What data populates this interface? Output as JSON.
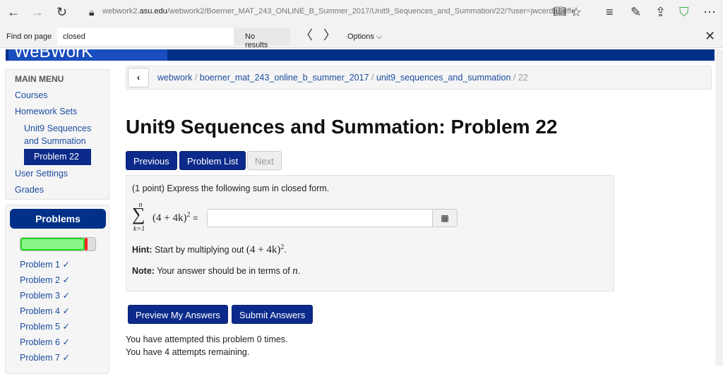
{
  "browser": {
    "url_prefix": "webwork2.",
    "url_domain": "asu.edu",
    "url_rest": "/webwork2/Boerner_MAT_243_ONLINE_B_Summer_2017/Unit9_Sequences_and_Summation/22/?user=jwcerda&effe"
  },
  "find": {
    "label": "Find on page",
    "value": "closed",
    "results": "No results",
    "options": "Options"
  },
  "banner": "WeBWorK",
  "menu": {
    "title": "MAIN MENU",
    "courses": "Courses",
    "homework_sets": "Homework Sets",
    "set_line1": "Unit9 Sequences",
    "set_line2": "and Summation",
    "problem": "Problem 22",
    "user_settings": "User Settings",
    "grades": "Grades"
  },
  "problems": {
    "title": "Problems",
    "progress": {
      "correct": 0.86,
      "incorrect": 0.04
    },
    "items": [
      "Problem 1 ✓",
      "Problem 2 ✓",
      "Problem 3 ✓",
      "Problem 4 ✓",
      "Problem 5 ✓",
      "Problem 6 ✓",
      "Problem 7 ✓"
    ]
  },
  "breadcrumb": {
    "items": [
      "webwork",
      "boerner_mat_243_online_b_summer_2017",
      "unit9_sequences_and_summation"
    ],
    "current": "22",
    "sep": "/"
  },
  "title": "Unit9 Sequences and Summation: Problem 22",
  "nav": {
    "previous": "Previous",
    "list": "Problem List",
    "next": "Next"
  },
  "problem": {
    "intro": "(1 point) Express the following sum in closed form.",
    "sum_top": "n",
    "sum_bottom": "k=1",
    "expr": "(4 + 4k)",
    "exp": "2",
    "eq": "=",
    "answer": "",
    "hint_label": "Hint:",
    "hint_text": "Start by multiplying out",
    "hint_expr": "(4 + 4k)",
    "note_label": "Note:",
    "note_text": "Your answer should be in terms of",
    "note_var": "n"
  },
  "actions": {
    "preview": "Preview My Answers",
    "submit": "Submit Answers"
  },
  "status": {
    "attempted": "You have attempted this problem 0 times.",
    "remaining": "You have 4 attempts remaining."
  }
}
